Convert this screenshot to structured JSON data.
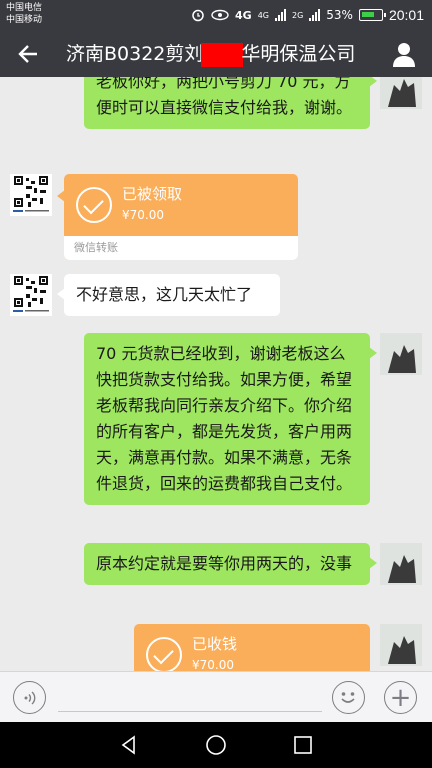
{
  "status_bar": {
    "carrier_1": "中国电信",
    "carrier_2": "中国移动",
    "network_1": "4G",
    "network_2": "4G",
    "network_3": "2G",
    "battery": "53%",
    "time": "20:01"
  },
  "header": {
    "title_part_1": "济南B0322剪刘",
    "title_part_2": "华明保温公司",
    "back_icon": "back-arrow-icon",
    "profile_icon": "person-icon"
  },
  "messages": [
    {
      "side": "right",
      "type": "text",
      "text": "老板你好，两把小号剪刀 70 元，方便时可以直接微信支付给我，谢谢。"
    },
    {
      "side": "left",
      "type": "transfer",
      "status": "已被领取",
      "amount": "¥70.00",
      "footer": "微信转账"
    },
    {
      "side": "left",
      "type": "text",
      "text": "不好意思，这几天太忙了"
    },
    {
      "side": "right",
      "type": "text",
      "text": "70 元货款已经收到，谢谢老板这么快把货款支付给我。如果方便，希望老板帮我向同行亲友介绍下。你介绍的所有客户，都是先发货，客户用两天，满意再付款。如果不满意，无条件退货，回来的运费都我自己支付。"
    },
    {
      "side": "right",
      "type": "text",
      "text": "原本约定就是要等你用两天的，没事"
    },
    {
      "side": "right",
      "type": "transfer",
      "status": "已收钱",
      "amount": "¥70.00",
      "footer": ""
    }
  ],
  "input_bar": {
    "voice_icon": "voice-icon",
    "emoji_icon": "emoji-icon",
    "plus_icon": "plus-icon",
    "plus_label": "+"
  },
  "colors": {
    "header_bg": "#393a3f",
    "chat_bg": "#ebebeb",
    "sent_bubble": "#9ee65f",
    "transfer_bg": "#fbae5a"
  }
}
